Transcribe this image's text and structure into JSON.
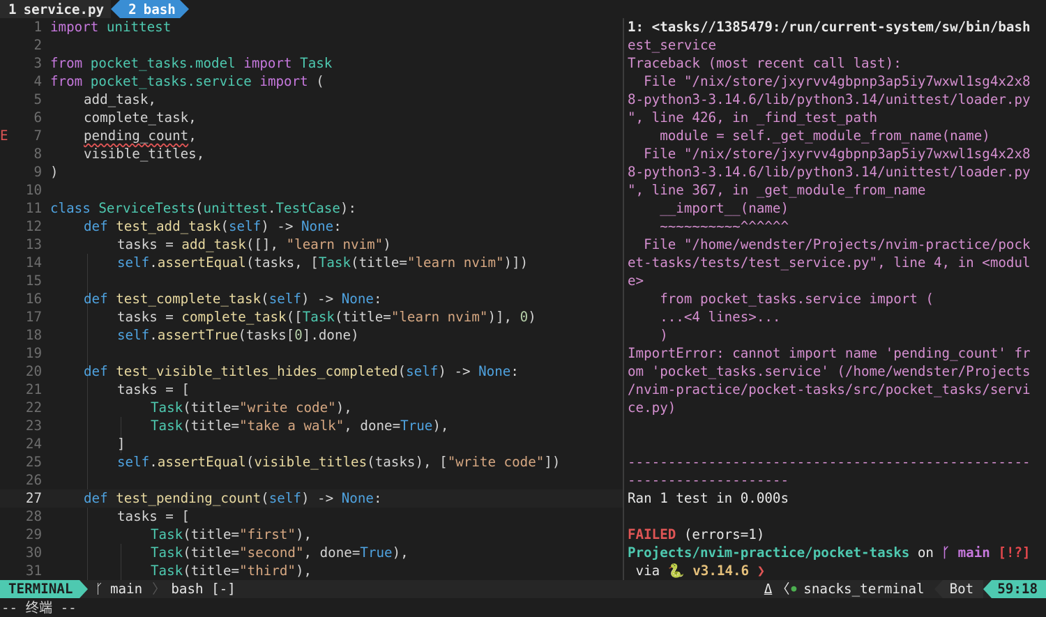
{
  "tabs": [
    {
      "num": "1",
      "label": "service.py",
      "active": false
    },
    {
      "num": "2",
      "label": "bash",
      "active": true
    }
  ],
  "editor": {
    "sign_error": "E",
    "lines": [
      {
        "n": "1"
      },
      {
        "n": "2"
      },
      {
        "n": "3"
      },
      {
        "n": "4"
      },
      {
        "n": "5"
      },
      {
        "n": "6"
      },
      {
        "n": "7"
      },
      {
        "n": "8"
      },
      {
        "n": "9"
      },
      {
        "n": "10"
      },
      {
        "n": "11"
      },
      {
        "n": "12"
      },
      {
        "n": "13"
      },
      {
        "n": "14"
      },
      {
        "n": "15"
      },
      {
        "n": "16"
      },
      {
        "n": "17"
      },
      {
        "n": "18"
      },
      {
        "n": "19"
      },
      {
        "n": "20"
      },
      {
        "n": "21"
      },
      {
        "n": "22"
      },
      {
        "n": "23"
      },
      {
        "n": "24"
      },
      {
        "n": "25"
      },
      {
        "n": "26"
      },
      {
        "n": "27"
      },
      {
        "n": "28"
      },
      {
        "n": "29"
      },
      {
        "n": "30"
      },
      {
        "n": "31"
      }
    ],
    "tokens": {
      "import": "import",
      "unittest": "unittest",
      "from": "from",
      "pocket_tasks": "pocket_tasks",
      "model": ".model",
      "service": ".service",
      "Task": "Task",
      "paren_open": " (",
      "add_task": "add_task,",
      "complete_task": "complete_task,",
      "pending_count": "pending_count",
      "comma": ",",
      "visible_titles": "visible_titles,",
      "paren_close": ")",
      "class": "class",
      "ServiceTests": "ServiceTests",
      "unittest_TestCase": "unittest",
      "TestCase": "TestCase",
      "def": "def",
      "test_add_task": "test_add_task",
      "self": "self",
      "arrow_none": " -> ",
      "None": "None",
      "tasks_assign": "tasks = ",
      "add_task_call": "add_task",
      "learn_nvim": "\"learn nvim\"",
      "assertEqual": "assertEqual",
      "title_kw": "title=",
      "test_complete_task": "test_complete_task",
      "complete_task_call": "complete_task",
      "zero": "0",
      "assertTrue": "assertTrue",
      "done_attr": ".done",
      "test_visible_titles_hides_completed": "test_visible_titles_hides_completed",
      "write_code": "\"write code\"",
      "take_a_walk": "\"take a walk\"",
      "done_kw": "done=",
      "True": "True",
      "visible_titles_call": "visible_titles",
      "test_pending_count": "test_pending_count",
      "first": "\"first\"",
      "second": "\"second\"",
      "third": "\"third\""
    }
  },
  "terminal": {
    "lines": [
      "1: <tasks//1385479:/run/current-system/sw/bin/bash",
      "est_service",
      "Traceback (most recent call last):",
      "  File \"/nix/store/jxyrvv4gbpnp3ap5iy7wxwl1sg4x2x8",
      "8-python3-3.14.6/lib/python3.14/unittest/loader.py",
      "\", line 426, in _find_test_path",
      "    module = self._get_module_from_name(name)",
      "  File \"/nix/store/jxyrvv4gbpnp3ap5iy7wxwl1sg4x2x8",
      "8-python3-3.14.6/lib/python3.14/unittest/loader.py",
      "\", line 367, in _get_module_from_name",
      "    __import__(name)",
      "    ~~~~~~~~~~^^^^^^",
      "  File \"/home/wendster/Projects/nvim-practice/pock",
      "et-tasks/tests/test_service.py\", line 4, in <modul",
      "e>",
      "    from pocket_tasks.service import (",
      "    ...<4 lines>...",
      "    )",
      "ImportError: cannot import name 'pending_count' fr",
      "om 'pocket_tasks.service' (/home/wendster/Projects",
      "/nvim-practice/pocket-tasks/src/pocket_tasks/servi",
      "ce.py)",
      "",
      "",
      "--------------------------------------------------",
      "--------------------",
      "Ran 1 test in 0.000s",
      "",
      "FAILED",
      " (errors=1)"
    ],
    "prompt_path": "Projects/nvim-practice/pocket-tasks",
    "prompt_on": " on ",
    "branch_icon": "ᚴ",
    "branch": "main",
    "git_status": "[!?]",
    "via": " via ",
    "python_icon": "🐍",
    "python_version": "v3.14.6",
    "prompt_char": "❯"
  },
  "statusline": {
    "mode": "TERMINAL",
    "branch_icon": "ᚴ",
    "branch": "main",
    "buffer": "bash [-]",
    "lsp_icon": "⍙",
    "chevron": "〈",
    "ft_icon": "●",
    "filetype": "snacks_terminal",
    "scroll": "Bot",
    "position": "59:18"
  },
  "cmdline": {
    "text": "-- 终端 --"
  },
  "colors": {
    "background": "#1e1e1e",
    "accent_teal": "#4ec9b0",
    "tab_active": "#3a8ed4",
    "error_red": "#e05555"
  }
}
